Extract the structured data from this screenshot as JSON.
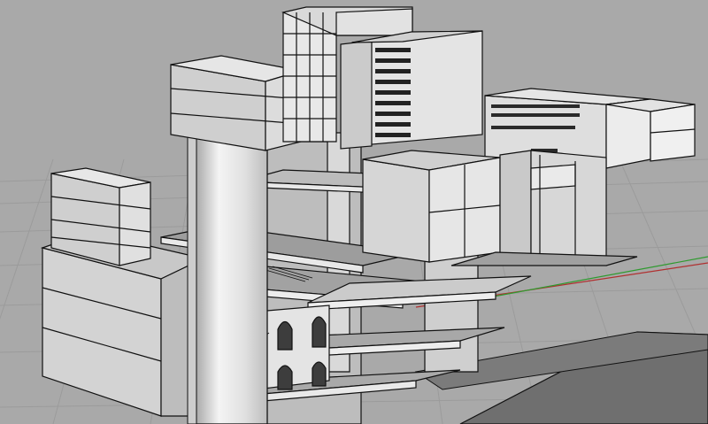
{
  "viewport": {
    "label": "",
    "background_color": "#a9a9a9",
    "grid_color": "#999999",
    "grid_on": true,
    "axis_x_color": "#b03030",
    "axis_y_color": "#2f9a2f",
    "face_light": "#e6e6e6",
    "face_mid": "#d0d0d0",
    "face_dark": "#b6b6b6",
    "edge_color": "#111111"
  },
  "model": {
    "name": "",
    "icon": "3d-model-icon"
  }
}
